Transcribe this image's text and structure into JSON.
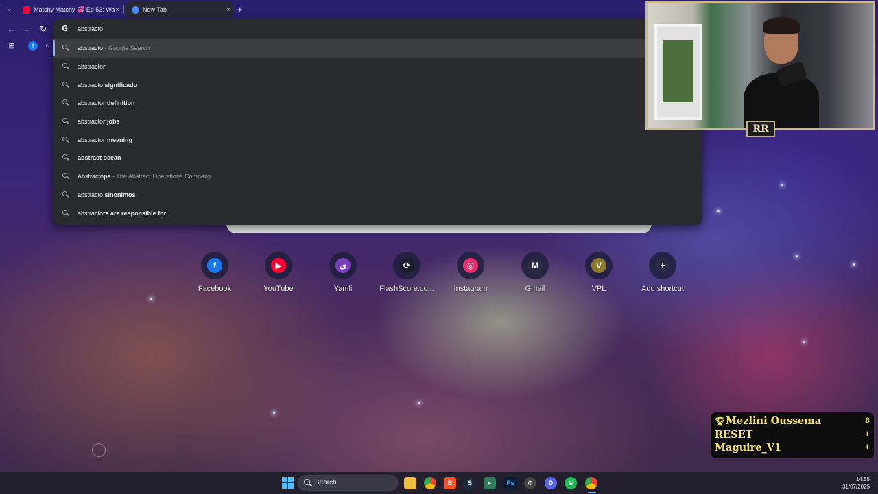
{
  "browser": {
    "tabs": [
      {
        "title": "Matchy Matchy 💞 Ep 53: Wa",
        "favicon": "youtube-icon"
      },
      {
        "title": "New Tab",
        "favicon": "chrome-icon"
      }
    ],
    "new_tab_symbol": "+",
    "close_symbol": "×"
  },
  "omnibox": {
    "query": "abstracto",
    "suggestions": [
      {
        "typed": "abstracto",
        "completion": "",
        "desc": "- Google Search"
      },
      {
        "typed": "abstracto",
        "completion": "r",
        "desc": ""
      },
      {
        "typed": "abstracto",
        "completion": " significado",
        "desc": ""
      },
      {
        "typed": "abstracto",
        "completion": "r definition",
        "desc": ""
      },
      {
        "typed": "abstracto",
        "completion": "r jobs",
        "desc": ""
      },
      {
        "typed": "abstracto",
        "completion": "r meaning",
        "desc": ""
      },
      {
        "typed": "",
        "completion": "abstract ocean",
        "desc": ""
      },
      {
        "typed": "Abstracto",
        "completion": "ps",
        "desc": "- The Abstract Operations Company"
      },
      {
        "typed": "abstracto",
        "completion": " sinonimos",
        "desc": ""
      },
      {
        "typed": "abstracto",
        "completion": "rs are responsible for",
        "desc": ""
      }
    ]
  },
  "shortcuts": [
    {
      "label": "Facebook",
      "glyph": "f",
      "color": "#1877f2"
    },
    {
      "label": "YouTube",
      "glyph": "▶",
      "color": "#ff0033"
    },
    {
      "label": "Yamli",
      "glyph": "ي",
      "color": "#7a3fc0"
    },
    {
      "label": "FlashScore.co...",
      "glyph": "⟳",
      "color": "#1b1b2a"
    },
    {
      "label": "Instagram",
      "glyph": "◎",
      "color": "#e1306c"
    },
    {
      "label": "Gmail",
      "glyph": "M",
      "color": "#2a2a44"
    },
    {
      "label": "VPL",
      "glyph": "V",
      "color": "#8a7a2a"
    },
    {
      "label": "Add shortcut",
      "glyph": "+",
      "color": "#2a2a44"
    }
  ],
  "leaderboard": [
    {
      "name": "Mezlini Oussema",
      "count": "8",
      "icon": "trophy-icon"
    },
    {
      "name": "RESET",
      "count": "1",
      "icon": ""
    },
    {
      "name": "Maguire_V1",
      "count": "1",
      "icon": ""
    }
  ],
  "stream_logo": "RR",
  "taskbar": {
    "search_placeholder": "Search",
    "time": "14:55",
    "date": "31/07/2025"
  }
}
